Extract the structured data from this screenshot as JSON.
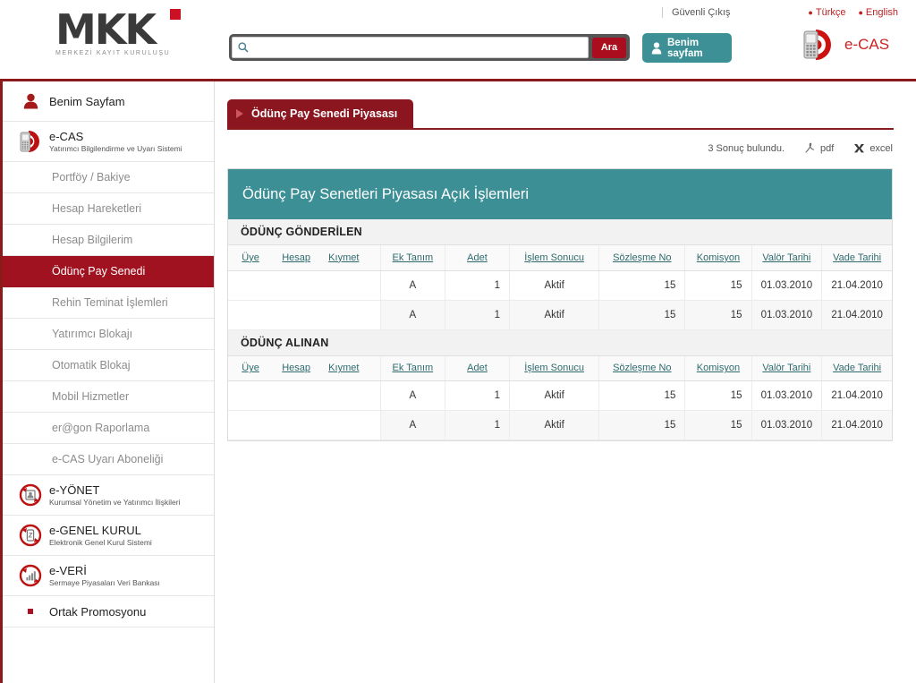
{
  "header": {
    "logo_text": "MKK",
    "logo_sub": "MERKEZİ KAYIT KURULUŞU",
    "search_placeholder": "",
    "search_value": "",
    "search_icon": "search-icon",
    "ara_label": "Ara",
    "benim_sayfam_label": "Benim sayfam",
    "guvenli_cikis": "Güvenli Çıkış",
    "lang_tr": "Türkçe",
    "lang_en": "English",
    "ecas_word": "e-CAS"
  },
  "sidebar": {
    "items": [
      {
        "label": "Benim Sayfam",
        "sub": "",
        "icon": "user-icon",
        "type": "top"
      },
      {
        "label": "e-CAS",
        "sub": "Yatırımcı Bilgilendirme ve Uyarı Sistemi",
        "icon": "ecas-phone-icon",
        "type": "top"
      },
      {
        "label": "Portföy / Bakiye",
        "sub": "",
        "icon": "",
        "type": "sub"
      },
      {
        "label": "Hesap Hareketleri",
        "sub": "",
        "icon": "",
        "type": "sub"
      },
      {
        "label": "Hesap Bilgilerim",
        "sub": "",
        "icon": "",
        "type": "sub"
      },
      {
        "label": "Ödünç Pay Senedi",
        "sub": "",
        "icon": "",
        "type": "sub",
        "active": true
      },
      {
        "label": "Rehin Teminat İşlemleri",
        "sub": "",
        "icon": "",
        "type": "sub"
      },
      {
        "label": "Yatırımcı Blokajı",
        "sub": "",
        "icon": "",
        "type": "sub"
      },
      {
        "label": "Otomatik Blokaj",
        "sub": "",
        "icon": "",
        "type": "sub"
      },
      {
        "label": "Mobil Hizmetler",
        "sub": "",
        "icon": "",
        "type": "sub"
      },
      {
        "label": "er@gon Raporlama",
        "sub": "",
        "icon": "",
        "type": "sub"
      },
      {
        "label": "e-CAS Uyarı Aboneliği",
        "sub": "",
        "icon": "",
        "type": "sub"
      },
      {
        "label": "e-YÖNET",
        "sub": "Kurumsal Yönetim ve Yatırımcı İlişkileri",
        "icon": "eyonet-icon",
        "type": "top"
      },
      {
        "label": "e-GENEL KURUL",
        "sub": "Elektronik Genel Kurul Sistemi",
        "icon": "egenelkurul-icon",
        "type": "top"
      },
      {
        "label": "e-VERİ",
        "sub": "Sermaye Piyasaları Veri Bankası",
        "icon": "everi-icon",
        "type": "top"
      },
      {
        "label": "Ortak Promosyonu",
        "sub": "",
        "icon": "square-bullet-icon",
        "type": "bullet"
      }
    ]
  },
  "main": {
    "tab_label": "Ödünç Pay Senedi Piyasası",
    "result_count_text": "3 Sonuç bulundu.",
    "pdf_label": "pdf",
    "excel_label": "excel",
    "panel_title": "Ödünç Pay Senetleri Piyasası Açık İşlemleri",
    "columns": [
      "Üye",
      "Hesap",
      "Kıymet",
      "Ek Tanım",
      "Adet",
      "İşlem Sonucu",
      "Sözleşme No",
      "Komisyon",
      "Valör Tarihi",
      "Vade Tarihi"
    ],
    "sections": [
      {
        "title": "ÖDÜNÇ GÖNDERİLEN",
        "rows": [
          {
            "uye": "",
            "hesap": "",
            "kiymet": "",
            "ek_tanim": "A",
            "adet": "1",
            "islem_sonucu": "Aktif",
            "sozlesme_no": "15",
            "komisyon": "15",
            "valor_tarihi": "01.03.2010",
            "vade_tarihi": "21.04.2010"
          },
          {
            "uye": "",
            "hesap": "",
            "kiymet": "",
            "ek_tanim": "A",
            "adet": "1",
            "islem_sonucu": "Aktif",
            "sozlesme_no": "15",
            "komisyon": "15",
            "valor_tarihi": "01.03.2010",
            "vade_tarihi": "21.04.2010"
          }
        ]
      },
      {
        "title": "ÖDÜNÇ ALINAN",
        "rows": [
          {
            "uye": "",
            "hesap": "",
            "kiymet": "",
            "ek_tanim": "A",
            "adet": "1",
            "islem_sonucu": "Aktif",
            "sozlesme_no": "15",
            "komisyon": "15",
            "valor_tarihi": "01.03.2010",
            "vade_tarihi": "21.04.2010"
          },
          {
            "uye": "",
            "hesap": "",
            "kiymet": "",
            "ek_tanim": "A",
            "adet": "1",
            "islem_sonucu": "Aktif",
            "sozlesme_no": "15",
            "komisyon": "15",
            "valor_tarihi": "01.03.2010",
            "vade_tarihi": "21.04.2010"
          }
        ]
      }
    ]
  },
  "colors": {
    "brand_red": "#8b1a1a",
    "active_red": "#a01220",
    "teal": "#3c8f95",
    "button_teal": "#3d9196",
    "ara_red": "#aa0e1e",
    "header_link_red": "#bb2222",
    "col_header_text": "#2f6b6e"
  }
}
